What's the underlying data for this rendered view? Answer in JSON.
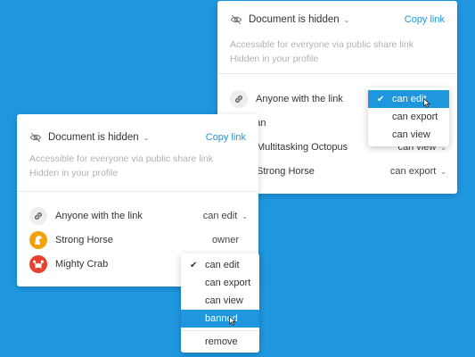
{
  "back_panel": {
    "title": "Document is hidden",
    "copy_link": "Copy link",
    "subtitle_line1": "Accessible for everyone via public share link",
    "subtitle_line2": "Hidden in your profile",
    "rows": [
      {
        "name": "Anyone with the link",
        "permission": ""
      },
      {
        "name": "lillian",
        "permission": ""
      },
      {
        "name": "Multitasking Octopus",
        "permission": "can view"
      },
      {
        "name": "Strong Horse",
        "permission": "can export"
      }
    ],
    "menu": [
      "can edit",
      "can export",
      "can view"
    ],
    "menu_selected": "can edit"
  },
  "front_panel": {
    "title": "Document is hidden",
    "copy_link": "Copy link",
    "subtitle_line1": "Accessible for everyone via public share link",
    "subtitle_line2": "Hidden in your profile",
    "rows": [
      {
        "name": "Anyone with the link",
        "permission": "can edit"
      },
      {
        "name": "Strong Horse",
        "permission": "owner"
      },
      {
        "name": "Mighty Crab",
        "permission": ""
      }
    ],
    "menu": [
      "can edit",
      "can export",
      "can view",
      "banned",
      "remove"
    ],
    "menu_checked": "can edit",
    "menu_hover": "banned"
  },
  "colors": {
    "background": "#1f97df",
    "accent": "#1f97df",
    "avatar_horse": "#f5a00d",
    "avatar_crab": "#e8412d"
  },
  "icons": [
    "eye-slash-icon",
    "chevron-down-icon",
    "link-icon",
    "horse-avatar-icon",
    "crab-avatar-icon",
    "checkmark-icon",
    "mouse-cursor-icon"
  ]
}
